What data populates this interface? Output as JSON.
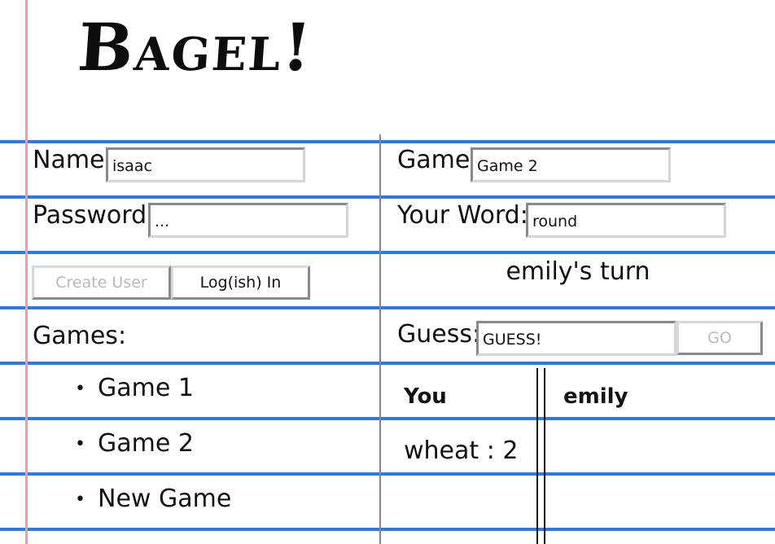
{
  "app": {
    "title": "Bagel!"
  },
  "login": {
    "name_label": "Name:",
    "name_value": "isaac",
    "password_label": "Password:",
    "password_value": "...",
    "create_user_label": "Create User",
    "login_label": "Log(ish) In"
  },
  "games": {
    "label": "Games:",
    "items": [
      "Game 1",
      "Game 2",
      "New Game"
    ]
  },
  "game_panel": {
    "game_label": "Game:",
    "game_value": "Game 2",
    "word_label": "Your Word:",
    "word_value": "round",
    "turn_text": "emily's turn",
    "guess_label": "Guess:",
    "guess_value": "GUESS!",
    "go_label": "GO"
  },
  "guesses": {
    "you_header": "You",
    "opponent_header": "emily",
    "you": [
      {
        "word": "wheat",
        "score": "2"
      }
    ]
  },
  "colors": {
    "rule_line": "#2f7be6",
    "margin_line": "#e8a0a8"
  }
}
